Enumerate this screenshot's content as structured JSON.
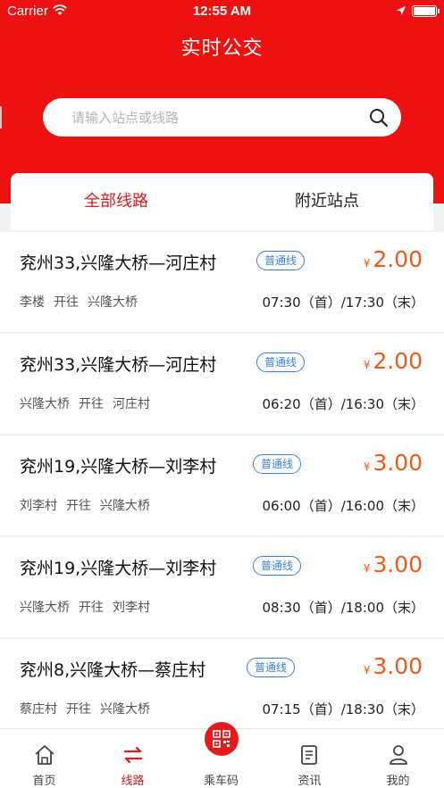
{
  "status_bar": {
    "carrier": "Carrier",
    "time": "12:55 AM"
  },
  "header": {
    "title": "实时公交"
  },
  "search": {
    "placeholder": "请输入站点或线路"
  },
  "tabs": {
    "all_lines": "全部线路",
    "nearby_stations": "附近站点"
  },
  "routes": [
    {
      "name": "兖州33,兴隆大桥—河庄村",
      "badge": "普通线",
      "currency": "¥",
      "price": "2.00",
      "from": "李楼",
      "direction": "开往",
      "to": "兴隆大桥",
      "times": "07:30（首）/17:30（末）"
    },
    {
      "name": "兖州33,兴隆大桥—河庄村",
      "badge": "普通线",
      "currency": "¥",
      "price": "2.00",
      "from": "兴隆大桥",
      "direction": "开往",
      "to": "河庄村",
      "times": "06:20（首）/16:30（末）"
    },
    {
      "name": "兖州19,兴隆大桥—刘李村",
      "badge": "普通线",
      "currency": "¥",
      "price": "3.00",
      "from": "刘李村",
      "direction": "开往",
      "to": "兴隆大桥",
      "times": "06:00（首）/16:00（末）"
    },
    {
      "name": "兖州19,兴隆大桥—刘李村",
      "badge": "普通线",
      "currency": "¥",
      "price": "3.00",
      "from": "兴隆大桥",
      "direction": "开往",
      "to": "刘李村",
      "times": "08:30（首）/18:00（末）"
    },
    {
      "name": "兖州8,兴隆大桥—蔡庄村",
      "badge": "普通线",
      "currency": "¥",
      "price": "3.00",
      "from": "蔡庄村",
      "direction": "开往",
      "to": "兴隆大桥",
      "times": "07:15（首）/18:30（末）"
    }
  ],
  "tabbar": {
    "home": "首页",
    "lines": "线路",
    "ride_code": "乘车码",
    "news": "资讯",
    "mine": "我的"
  },
  "colors": {
    "brand_red": "#ee1111",
    "price_orange": "#f25a1c",
    "badge_blue": "#3b7fe0"
  }
}
